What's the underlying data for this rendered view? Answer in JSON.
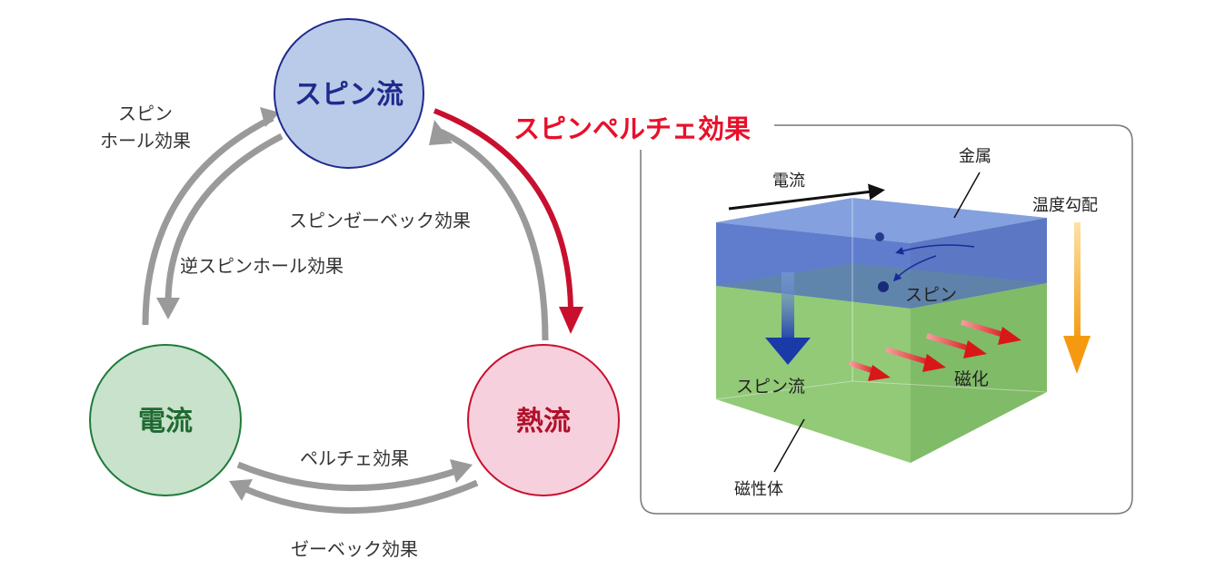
{
  "nodes": {
    "spin_current": "スピン流",
    "charge_current": "電流",
    "heat_current": "熱流"
  },
  "effects": {
    "spin_hall_line1": "スピン",
    "spin_hall_line2": "ホール効果",
    "inverse_spin_hall": "逆スピンホール効果",
    "spin_seebeck": "スピンゼーベック効果",
    "peltier": "ペルチェ効果",
    "seebeck": "ゼーベック効果",
    "spin_peltier": "スピンペルチェ効果"
  },
  "inset": {
    "electric_current": "電流",
    "metal": "金属",
    "temperature_gradient": "温度勾配",
    "spin": "スピン",
    "spin_current": "スピン流",
    "magnetization": "磁化",
    "magnet": "磁性体"
  },
  "colors": {
    "spin_node_fill": "#b9cbe8",
    "spin_node_stroke": "#1f2a8c",
    "charge_node_fill": "#c8e2cb",
    "charge_node_stroke": "#1f7a3a",
    "heat_node_fill": "#f7d0dd",
    "heat_node_stroke": "#c8102e",
    "gray_arrow": "#9a9a9a",
    "red_arrow": "#c8102e",
    "title_red": "#e8102a",
    "metal_layer": "#5a78c8",
    "magnet_layer": "#7cbf64",
    "orange_arrow": "#f5a623"
  }
}
